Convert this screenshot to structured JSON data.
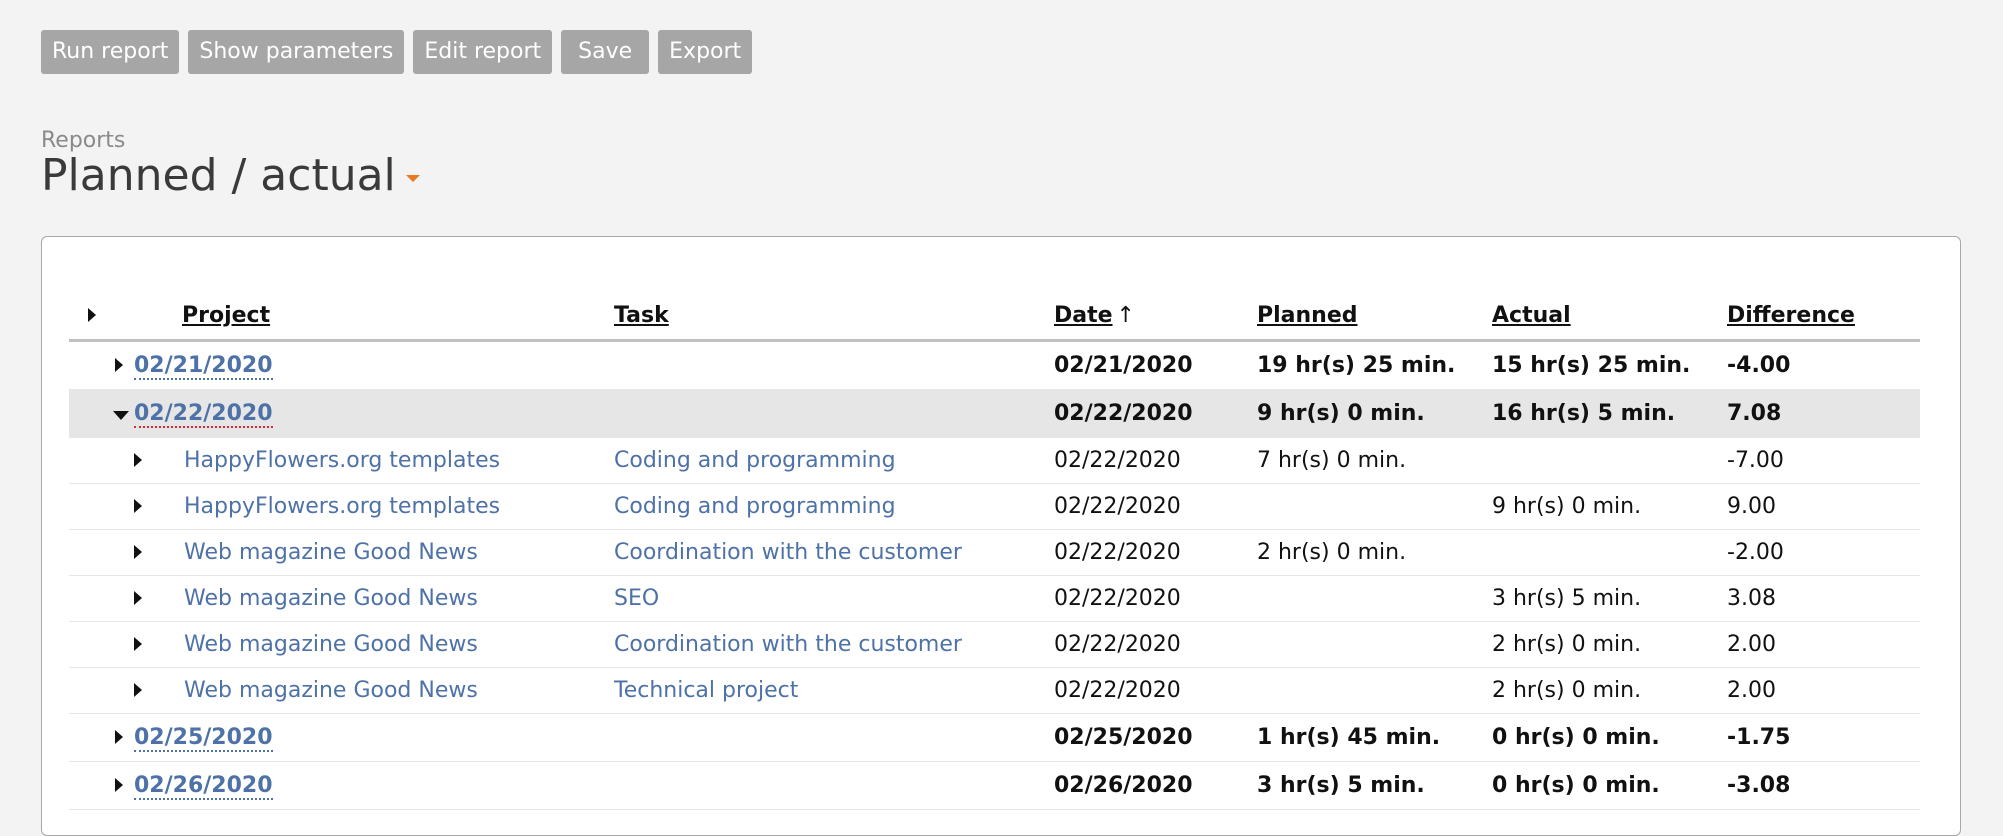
{
  "toolbar": {
    "run_report": "Run report",
    "show_parameters": "Show parameters",
    "edit_report": "Edit report",
    "save": "Save",
    "export": "Export"
  },
  "breadcrumb": "Reports",
  "title": "Planned / actual",
  "accent_color": "#e87a22",
  "link_color": "#4e72a8",
  "table": {
    "columns": {
      "project": "Project",
      "task": "Task",
      "date": "Date",
      "date_sort_indicator": "↑",
      "planned": "Planned",
      "actual": "Actual",
      "difference": "Difference"
    },
    "groups": [
      {
        "label": "02/21/2020",
        "date": "02/21/2020",
        "planned": "19 hr(s) 25 min.",
        "actual": "15 hr(s) 25 min.",
        "difference": "-4.00"
      },
      {
        "label": "02/22/2020",
        "date": "02/22/2020",
        "planned": "9 hr(s) 0 min.",
        "actual": "16 hr(s) 5 min.",
        "difference": "7.08"
      },
      {
        "label": "02/25/2020",
        "date": "02/25/2020",
        "planned": "1 hr(s) 45 min.",
        "actual": "0 hr(s) 0 min.",
        "difference": "-1.75"
      },
      {
        "label": "02/26/2020",
        "date": "02/26/2020",
        "planned": "3 hr(s) 5 min.",
        "actual": "0 hr(s) 0 min.",
        "difference": "-3.08"
      }
    ],
    "detail_rows": [
      {
        "project": "HappyFlowers.org templates",
        "task": "Coding and programming",
        "date": "02/22/2020",
        "planned": "7 hr(s) 0 min.",
        "actual": "",
        "difference": "-7.00"
      },
      {
        "project": "HappyFlowers.org templates",
        "task": "Coding and programming",
        "date": "02/22/2020",
        "planned": "",
        "actual": "9 hr(s) 0 min.",
        "difference": "9.00"
      },
      {
        "project": "Web magazine Good News",
        "task": "Coordination with the customer",
        "date": "02/22/2020",
        "planned": "2 hr(s) 0 min.",
        "actual": "",
        "difference": "-2.00"
      },
      {
        "project": "Web magazine Good News",
        "task": "SEO",
        "date": "02/22/2020",
        "planned": "",
        "actual": "3 hr(s) 5 min.",
        "difference": "3.08"
      },
      {
        "project": "Web magazine Good News",
        "task": "Coordination with the customer",
        "date": "02/22/2020",
        "planned": "",
        "actual": "2 hr(s) 0 min.",
        "difference": "2.00"
      },
      {
        "project": "Web magazine Good News",
        "task": "Technical project",
        "date": "02/22/2020",
        "planned": "",
        "actual": "2 hr(s) 0 min.",
        "difference": "2.00"
      }
    ]
  }
}
